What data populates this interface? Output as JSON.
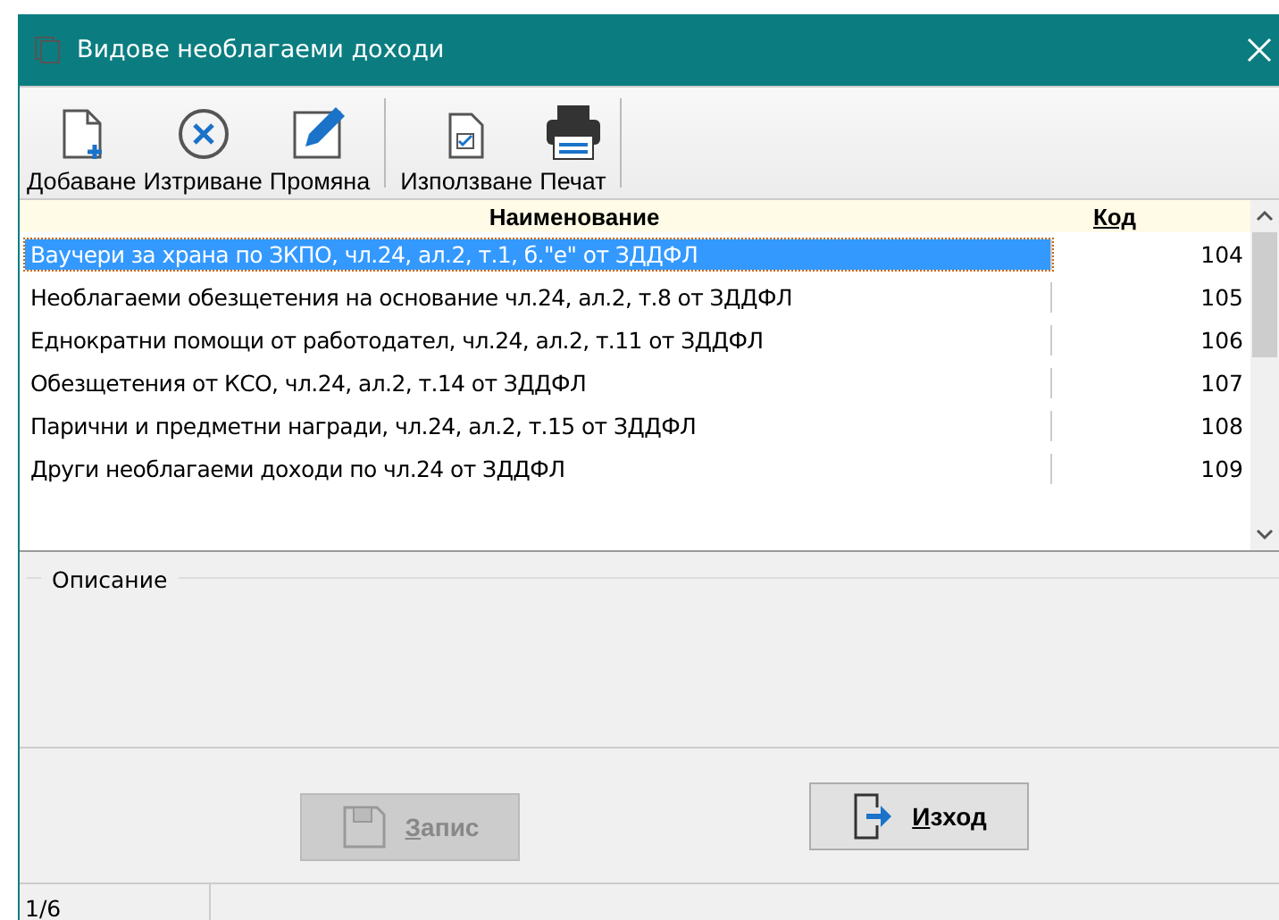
{
  "window": {
    "title": "Видове необлагаеми доходи"
  },
  "toolbar": [
    {
      "label": "Добаване",
      "kind": "add"
    },
    {
      "label": "Изтриване",
      "kind": "delete"
    },
    {
      "label": "Промяна",
      "kind": "edit"
    },
    {
      "label": "Използване",
      "kind": "use",
      "group_start": true
    },
    {
      "label": "Печат",
      "kind": "print"
    }
  ],
  "table": {
    "columns": [
      "Наименование",
      "Код"
    ],
    "rows": [
      {
        "name": "Ваучери за храна по ЗКПО, чл.24, ал.2, т.1, б.\"е\" от ЗДДФЛ",
        "code": "104",
        "selected": true
      },
      {
        "name": "Необлагаеми обезщетения на основание чл.24, ал.2, т.8 от ЗДДФЛ",
        "code": "105",
        "selected": false
      },
      {
        "name": "Еднократни помощи от работодател, чл.24, ал.2, т.11 от ЗДДФЛ",
        "code": "106",
        "selected": false
      },
      {
        "name": "Обезщетения от КСО, чл.24, ал.2, т.14 от ЗДДФЛ",
        "code": "107",
        "selected": false
      },
      {
        "name": "Парични и предметни награди, чл.24, ал.2, т.15 от ЗДДФЛ",
        "code": "108",
        "selected": false
      },
      {
        "name": "Други необлагаеми доходи по чл.24 от ЗДДФЛ",
        "code": "109",
        "selected": false
      }
    ]
  },
  "description": {
    "label": "Описание"
  },
  "buttons": [
    {
      "label": "Запис",
      "kind": "save",
      "disabled": true,
      "underline_first": true
    },
    {
      "label": "Изход",
      "kind": "exit",
      "disabled": false,
      "underline_first": true
    }
  ],
  "status_bar": [
    "1/6"
  ]
}
